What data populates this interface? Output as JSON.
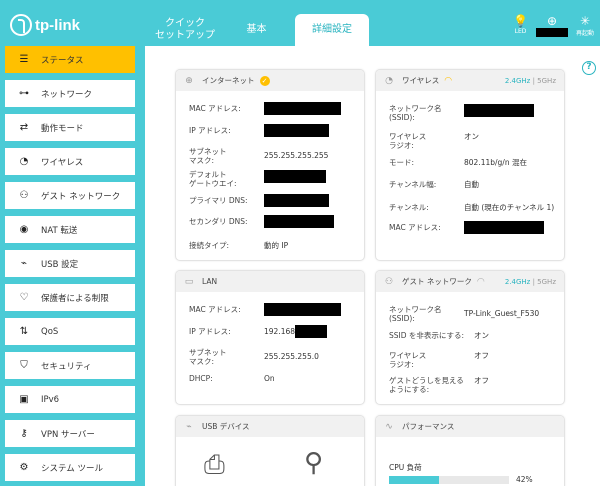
{
  "logo": {
    "text": "tp-link"
  },
  "top_tabs": [
    {
      "line1": "クイック",
      "line2": "セットアップ"
    },
    {
      "line1": "基本",
      "line2": ""
    },
    {
      "line1": "詳細設定",
      "line2": ""
    }
  ],
  "header_icons": {
    "led_label": "LED",
    "reboot_label": "再起動"
  },
  "sidebar": {
    "items": [
      {
        "label": "ステータス"
      },
      {
        "label": "ネットワーク"
      },
      {
        "label": "動作モード"
      },
      {
        "label": "ワイヤレス"
      },
      {
        "label": "ゲスト ネットワーク"
      },
      {
        "label": "NAT 転送"
      },
      {
        "label": "USB 設定"
      },
      {
        "label": "保護者による制限"
      },
      {
        "label": "QoS"
      },
      {
        "label": "セキュリティ"
      },
      {
        "label": "IPv6"
      },
      {
        "label": "VPN サーバー"
      },
      {
        "label": "システム ツール"
      }
    ]
  },
  "help": "?",
  "internet": {
    "title": "インターネット",
    "mac_label": "MAC アドレス:",
    "ip_label": "IP アドレス:",
    "subnet_label": "サブネット\nマスク:",
    "subnet_value": "255.255.255.255",
    "gateway_label": "デフォルト\nゲートウエイ:",
    "dns1_label": "プライマリ DNS:",
    "dns2_label": "セカンダリ DNS:",
    "conn_type_label": "接続タイプ:",
    "conn_type_value": "動的 IP"
  },
  "wireless": {
    "title": "ワイヤレス",
    "band_24": "2.4GHz",
    "band_sep": "|",
    "band_5": "5GHz",
    "ssid_label": "ネットワーク名\n(SSID):",
    "radio_label": "ワイヤレス\nラジオ:",
    "radio_value": "オン",
    "mode_label": "モード:",
    "mode_value": "802.11b/g/n 混在",
    "width_label": "チャンネル幅:",
    "width_value": "自動",
    "channel_label": "チャンネル:",
    "channel_value": "自動 (現在のチャンネル 1)",
    "mac_label": "MAC アドレス:"
  },
  "lan": {
    "title": "LAN",
    "mac_label": "MAC アドレス:",
    "ip_label": "IP アドレス:",
    "ip_value": "192.168",
    "subnet_label": "サブネット\nマスク:",
    "subnet_value": "255.255.255.0",
    "dhcp_label": "DHCP:",
    "dhcp_value": "On"
  },
  "guest": {
    "title": "ゲスト ネットワーク",
    "band_24": "2.4GHz",
    "band_sep": "|",
    "band_5": "5GHz",
    "ssid_label": "ネットワーク名\n(SSID):",
    "ssid_value": "TP-Link_Guest_F530",
    "hide_label": "SSID を非表示にする:",
    "hide_value": "オン",
    "radio_label": "ワイヤレス\nラジオ:",
    "radio_value": "オフ",
    "see_label": "ゲストどうしを見える\nようにする:",
    "see_value": "オフ"
  },
  "usb": {
    "title": "USB デバイス"
  },
  "performance": {
    "title": "パフォーマンス",
    "cpu_label": "CPU 負荷",
    "cpu_value": "42%",
    "cpu_fraction": 0.42
  },
  "colors": {
    "accent": "#4acbd6",
    "active": "#ffc000"
  }
}
